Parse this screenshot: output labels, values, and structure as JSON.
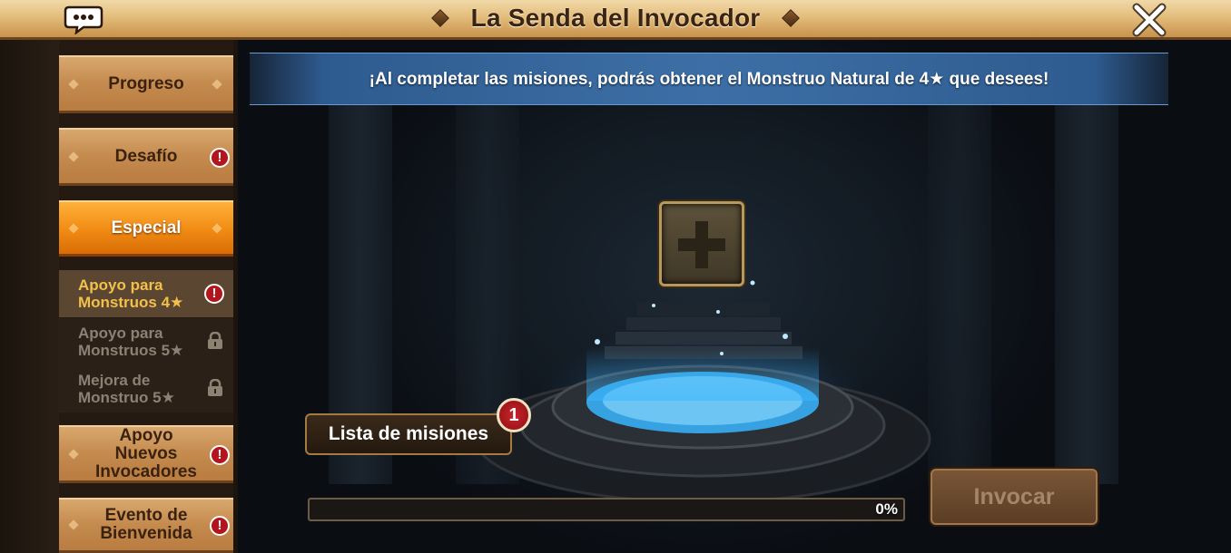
{
  "header": {
    "title": "La Senda del Invocador",
    "chat_icon": "chat-bubble-icon",
    "close_icon": "close-x-icon"
  },
  "sidebar": {
    "items": [
      {
        "label": "Progreso",
        "alert": false
      },
      {
        "label": "Desafío",
        "alert": true
      },
      {
        "label": "Especial",
        "alert": false,
        "active": true
      },
      {
        "label": "Apoyo Nuevos Invocadores",
        "alert": true
      },
      {
        "label": "Evento de Bienvenida",
        "alert": true
      }
    ],
    "subitems": [
      {
        "label": "Apoyo para Monstruos 4★",
        "state": "alert",
        "selected": true
      },
      {
        "label": "Apoyo para Monstruos 5★",
        "state": "locked"
      },
      {
        "label": "Mejora de Monstruo 5★",
        "state": "locked"
      }
    ],
    "alert_symbol": "!"
  },
  "main": {
    "banner_text": "¡Al completar las misiones, podrás obtener el Monstruo Natural de 4★ que desees!",
    "mission_button": "Lista de misiones",
    "mission_badge": "1",
    "progress_percent": 0,
    "progress_label": "0%",
    "invoke_button": "Invocar"
  },
  "colors": {
    "title_bar": "#e3bd7c",
    "active_tab": "#f08a13",
    "menu_tab": "#c48a4e",
    "alert": "#b4141c",
    "banner": "#3d6fa6",
    "progress_fill": "#e0a43a"
  }
}
